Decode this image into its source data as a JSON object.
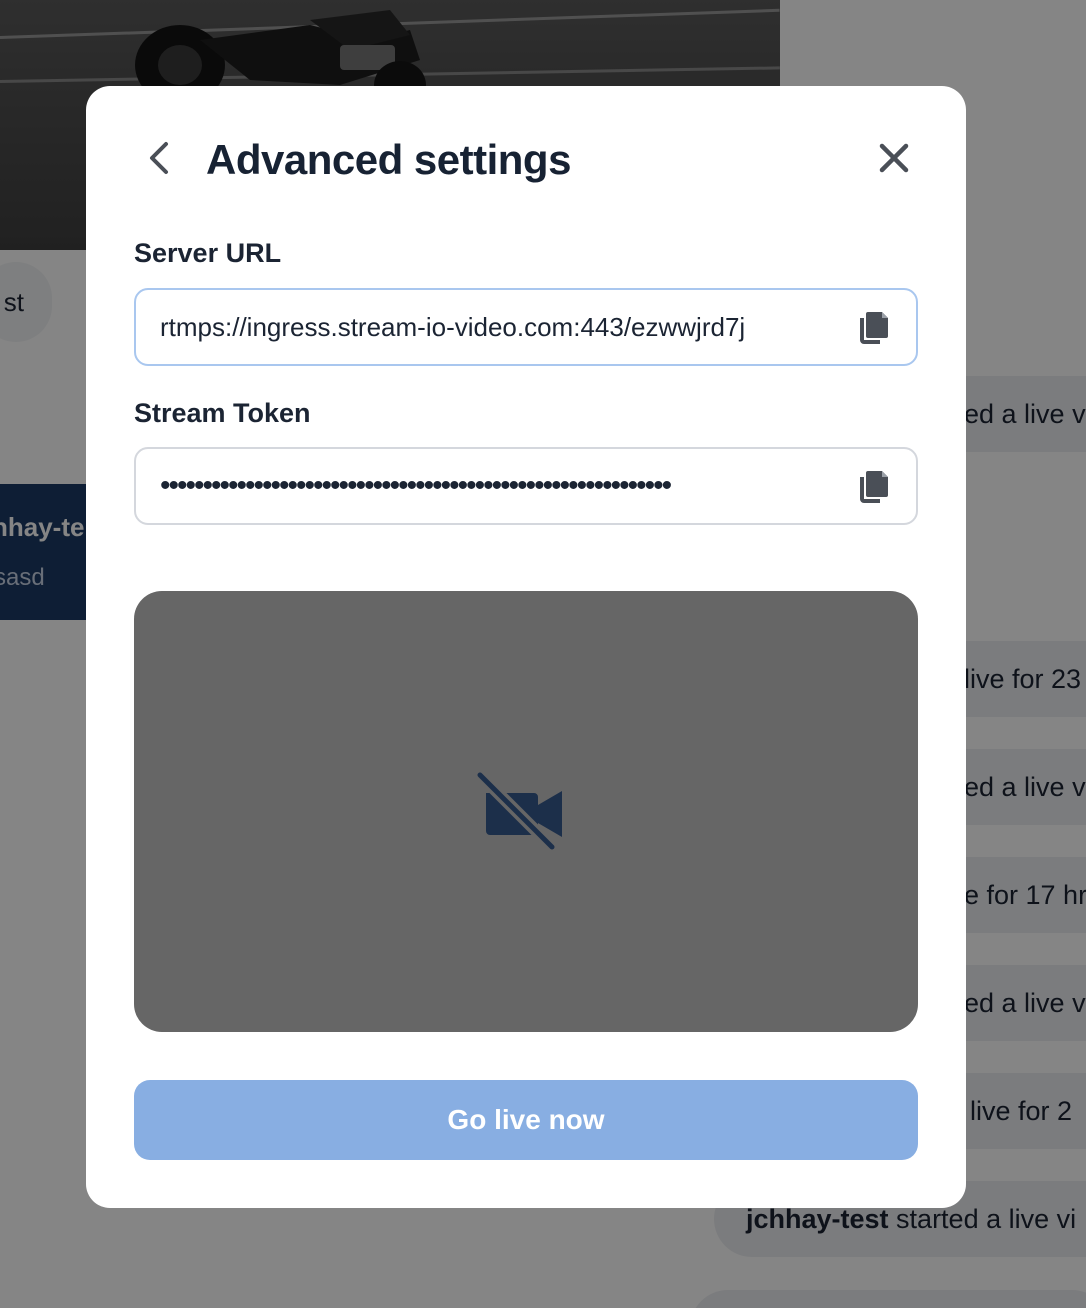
{
  "modal": {
    "title": "Advanced settings",
    "server_url": {
      "label": "Server URL",
      "value": "rtmps://ingress.stream-io-video.com:443/ezwwjrd7j"
    },
    "stream_token": {
      "label": "Stream Token",
      "value": "••••••••••••••••••••••••••••••••••••••••••••••••••••••••••••"
    },
    "go_live_label": "Go live now"
  },
  "background": {
    "chip_text": "st",
    "card": {
      "name": "hhay-te",
      "subtitle": "sasd"
    },
    "feed": [
      {
        "text": "ed a live v"
      },
      {
        "text": "live for 23"
      },
      {
        "text": "ed a live v"
      },
      {
        "text": "e for 17 hr"
      },
      {
        "text": "ed a live v"
      },
      {
        "text": "live for 2"
      },
      {
        "user": "jchhay-test",
        "text": " started a live vi"
      }
    ]
  },
  "icons": {
    "back": "chevron-left-icon",
    "close": "close-icon",
    "copy": "copy-icon",
    "camera_off": "video-off-icon"
  },
  "colors": {
    "accent": "#88aee2",
    "title": "#172233",
    "focus_border": "#a9c7ef",
    "preview_bg": "#666666",
    "icon_dark": "#1c2f4a"
  }
}
